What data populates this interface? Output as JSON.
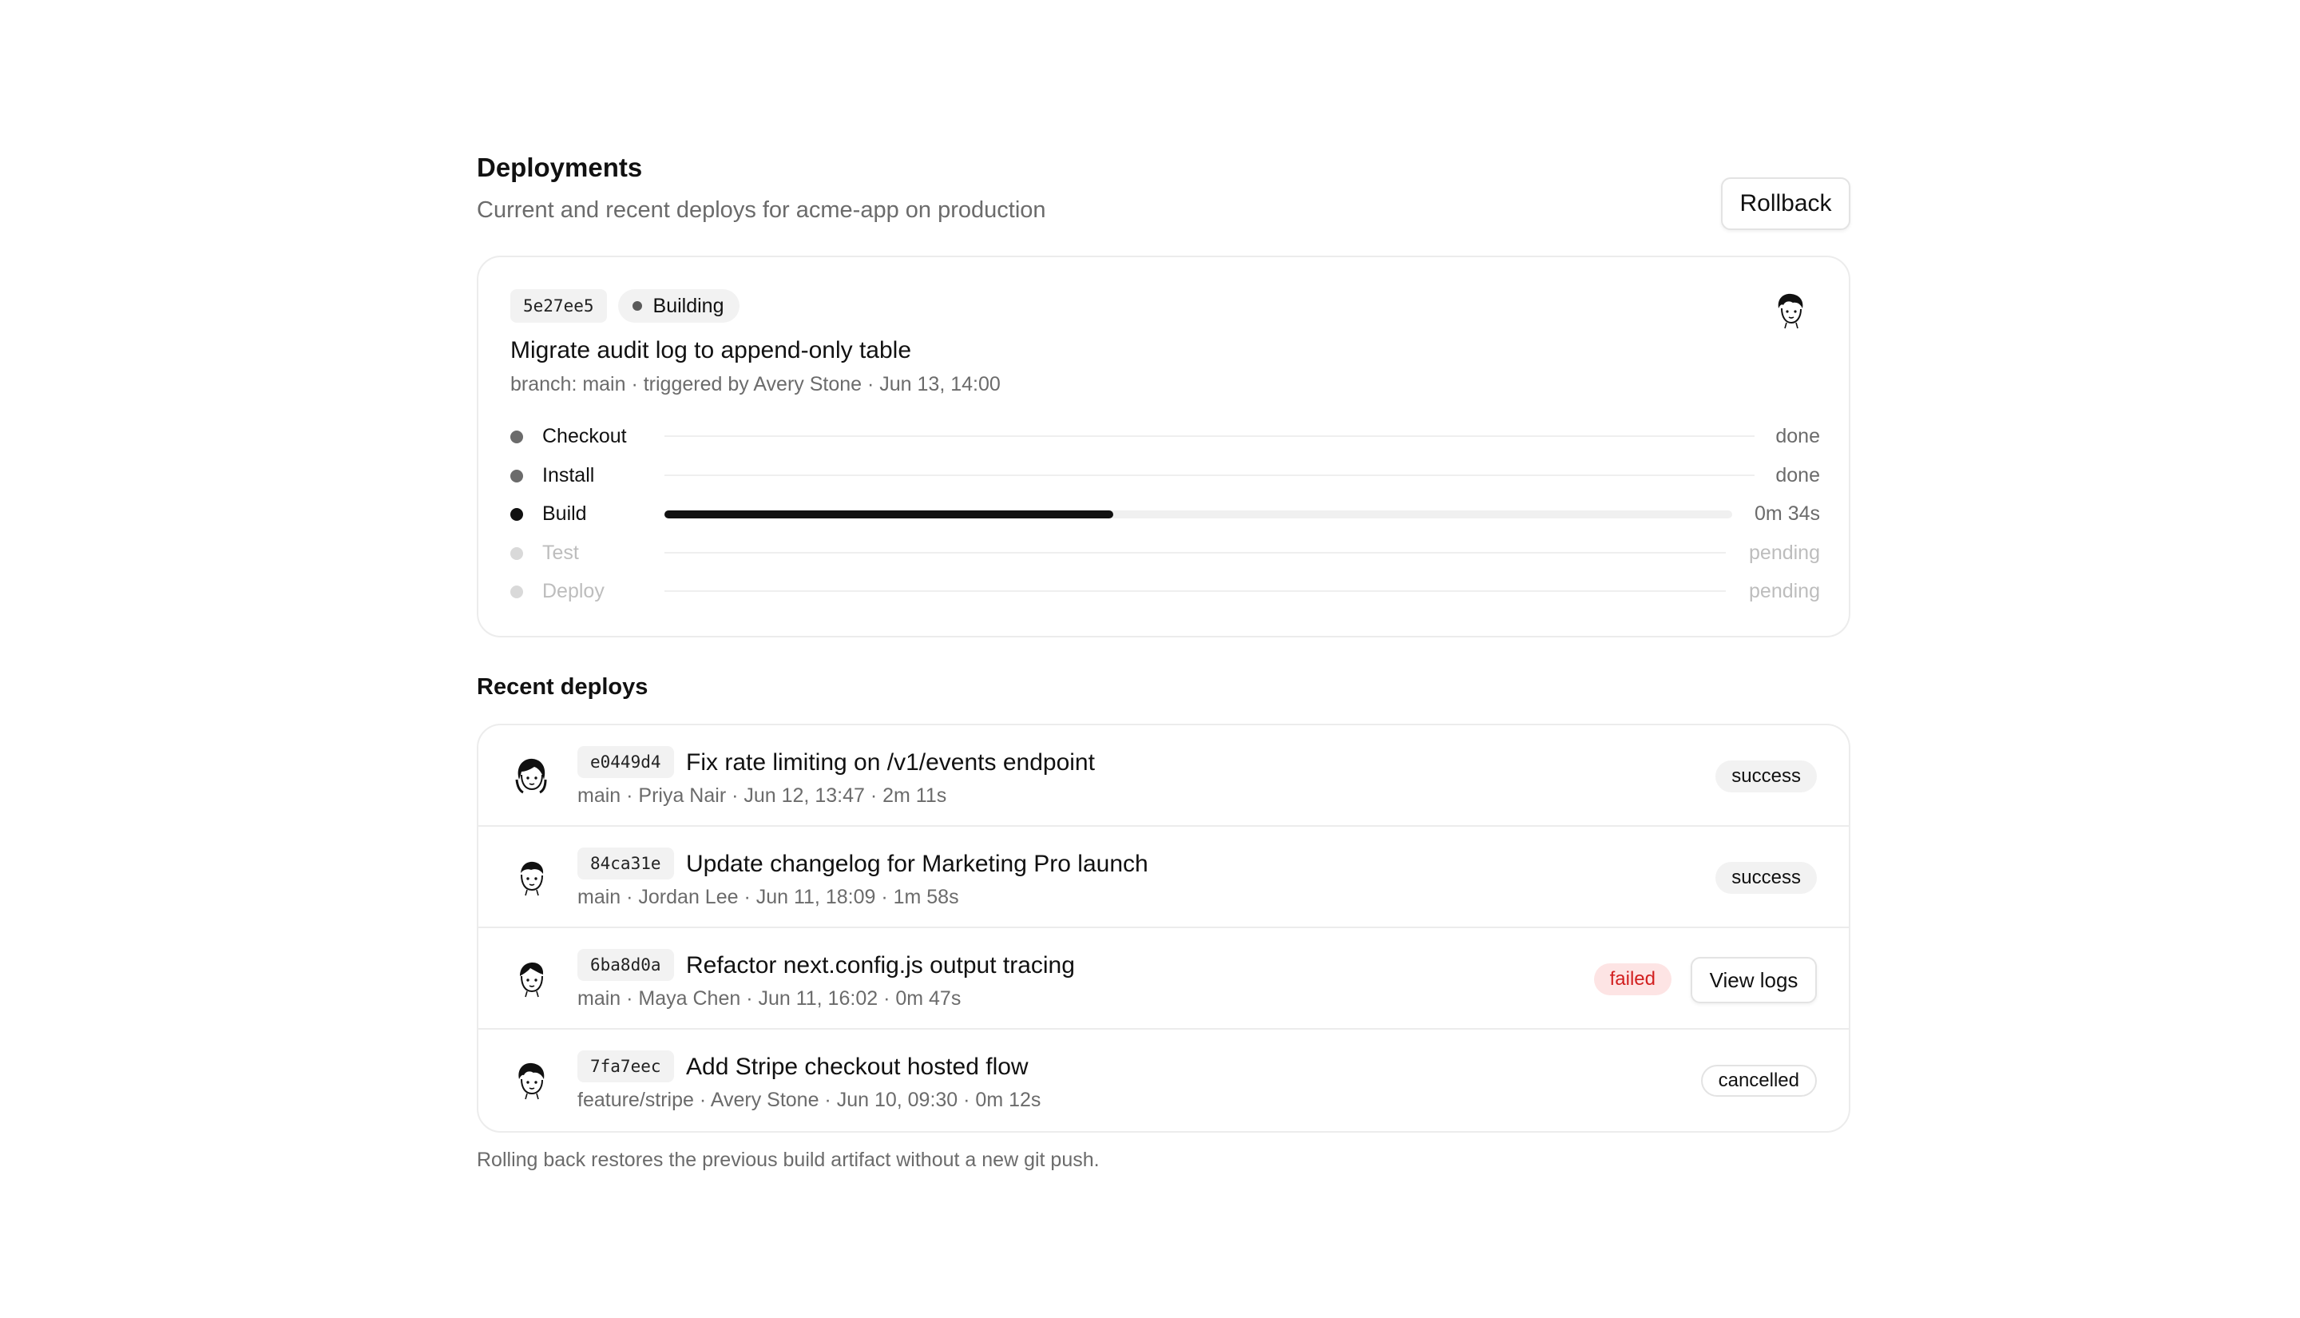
{
  "header": {
    "title": "Deployments",
    "subtitle": "Current and recent deploys for acme-app on production",
    "rollback_label": "Rollback"
  },
  "current": {
    "hash": "5e27ee5",
    "status": "Building",
    "message": "Migrate audit log to append-only table",
    "meta": "branch: main · triggered by Avery Stone · Jun 13, 14:00",
    "steps": [
      {
        "label": "Checkout",
        "status": "done"
      },
      {
        "label": "Install",
        "status": "done"
      },
      {
        "label": "Build",
        "status": "0m 34s",
        "progress": 0.42
      },
      {
        "label": "Test",
        "status": "pending"
      },
      {
        "label": "Deploy",
        "status": "pending"
      }
    ]
  },
  "recent": {
    "title": "Recent deploys",
    "rows": [
      {
        "hash": "e0449d4",
        "message": "Fix rate limiting on /v1/events endpoint",
        "meta": "main · Priya Nair · Jun 12, 13:47 · 2m 11s",
        "badge": "success"
      },
      {
        "hash": "84ca31e",
        "message": "Update changelog for Marketing Pro launch",
        "meta": "main · Jordan Lee · Jun 11, 18:09 · 1m 58s",
        "badge": "success"
      },
      {
        "hash": "6ba8d0a",
        "message": "Refactor next.config.js output tracing",
        "meta": "main · Maya Chen · Jun 11, 16:02 · 0m 47s",
        "badge": "failed",
        "action": "View logs"
      },
      {
        "hash": "7fa7eec",
        "message": "Add Stripe checkout hosted flow",
        "meta": "feature/stripe · Avery Stone · Jun 10, 09:30 · 0m 12s",
        "badge": "cancelled"
      }
    ]
  },
  "footnote": "Rolling back restores the previous build artifact without a new git push."
}
